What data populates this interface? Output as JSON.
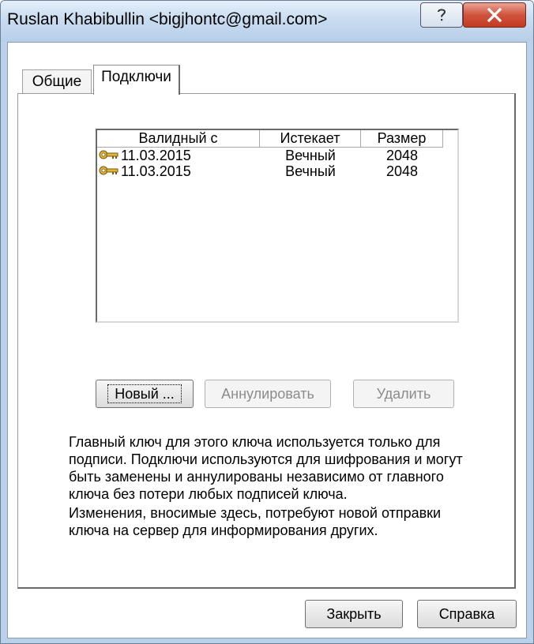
{
  "window": {
    "title": "Ruslan Khabibullin <bigjhontc@gmail.com>",
    "help_icon": "question-mark",
    "close_icon": "close-x"
  },
  "tabs": [
    {
      "label": "Общие",
      "selected": false
    },
    {
      "label": "Подключи",
      "selected": true
    }
  ],
  "subkeys": {
    "columns": [
      "Валидный с",
      "Истекает",
      "Размер"
    ],
    "rows": [
      {
        "icon": "key-icon",
        "valid_from": "11.03.2015",
        "expires": "Вечный",
        "size": "2048"
      },
      {
        "icon": "key-icon",
        "valid_from": "11.03.2015",
        "expires": "Вечный",
        "size": "2048"
      }
    ],
    "buttons": {
      "new": "Новый ...",
      "revoke": "Аннулировать",
      "delete": "Удалить"
    },
    "description_1": "Главный ключ для этого ключа используется только для подписи. Подключи используются для шифрования и могут быть заменены и аннулированы независимо от главного ключа без потери любых подписей ключа.",
    "description_2": "Изменения, вносимые здесь, потребуют новой отправки ключа на сервер для информирования других."
  },
  "footer": {
    "close": "Закрыть",
    "help": "Справка"
  },
  "colors": {
    "close_button": "#c8432b",
    "key_icon": "#d9a520"
  }
}
